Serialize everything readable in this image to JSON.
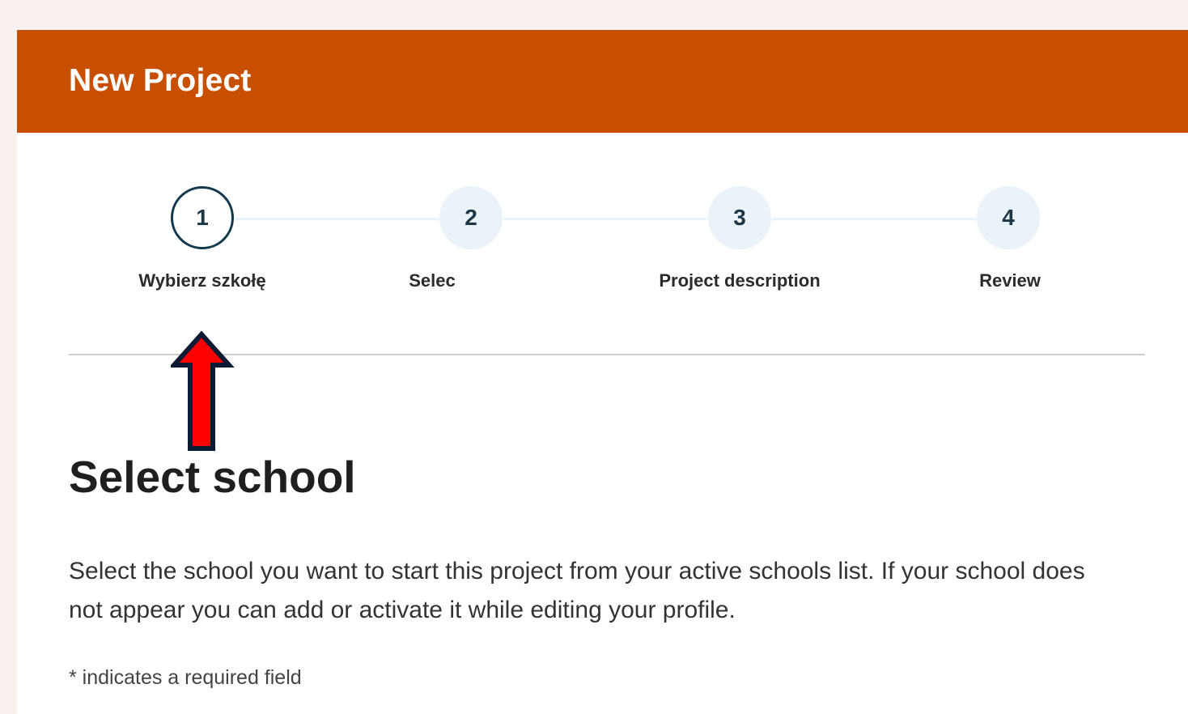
{
  "header": {
    "title": "New Project",
    "background_color": "#c94f00"
  },
  "stepper": {
    "steps": [
      {
        "number": "1",
        "label": "Wybierz szkołę",
        "state": "active"
      },
      {
        "number": "2",
        "label": "Selec",
        "state": "inactive"
      },
      {
        "number": "3",
        "label": "Project description",
        "state": "inactive"
      },
      {
        "number": "4",
        "label": "Review",
        "state": "inactive"
      }
    ],
    "active_border_color": "#12394d",
    "inactive_fill_color": "#e9f3f8"
  },
  "annotation": {
    "icon": "red-up-arrow-icon",
    "color": "#ff0000"
  },
  "main": {
    "title": "Select school",
    "description": "Select the school you want to start this project from your active schools list. If your school does not appear you can add or activate it while editing your profile.",
    "required_note": "* indicates a required field"
  }
}
